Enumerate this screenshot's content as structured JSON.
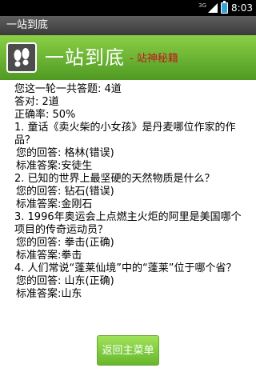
{
  "status_bar": {
    "network": "3G",
    "time": "8:03"
  },
  "app_title": "一站到底",
  "banner": {
    "title": "一站到底",
    "subtitle": "- 站神秘籍"
  },
  "summary": {
    "total": "您这一轮一共答题: 4道",
    "correct": "答对: 2道",
    "accuracy": "正确率: 50%"
  },
  "questions": [
    {
      "question": "1. 童话《卖火柴的小女孩》是丹麦哪位作家的作品？",
      "your_answer": "您的回答: 格林(错误)",
      "standard_answer": "标准答案:安徒生"
    },
    {
      "question": "2. 已知的世界上最坚硬的天然物质是什么？",
      "your_answer": "您的回答: 钻石(错误)",
      "standard_answer": "标准答案:金刚石"
    },
    {
      "question": "3. 1996年奥运会上点燃主火炬的阿里是美国哪个项目的传奇运动员？",
      "your_answer": "您的回答: 拳击(正确)",
      "standard_answer": "标准答案:拳击"
    },
    {
      "question": "4. 人们常说“蓬莱仙境”中的“蓬莱”位于哪个省？",
      "your_answer": "您的回答: 山东(正确)",
      "standard_answer": "标准答案:山东"
    }
  ],
  "button": {
    "back_main_menu": "返回主菜单"
  },
  "colors": {
    "banner_green": "#6fb536",
    "subtitle_red": "#c1171b",
    "title_bar": "#444444"
  }
}
